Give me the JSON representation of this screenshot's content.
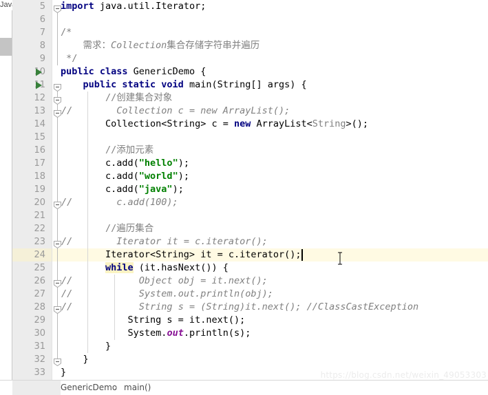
{
  "window": {
    "tab_stub_label": "Java",
    "breadcrumb": {
      "class_label": "GenericDemo",
      "separator": "›",
      "method_label": "main()"
    },
    "watermark": "https://blog.csdn.net/weixin_49053303"
  },
  "colors": {
    "keyword": "#000080",
    "string": "#008000",
    "comment": "#808080",
    "static_field": "#871094",
    "caret_line": "#fffae3",
    "identifier_highlight": "#fbf3c3",
    "gutter_bg": "#ececec",
    "editor_bg": "#ffffff",
    "line_number": "#999999",
    "run_marker": "#37803a"
  },
  "editor": {
    "caret_line_number": 24,
    "first_visible_line": 5,
    "last_visible_line": 33,
    "lines": [
      {
        "n": 5,
        "indent": 0,
        "run": false,
        "fold": "minus",
        "text_html": "<span class=\"kw\">import</span> java.util.Iterator;"
      },
      {
        "n": 6,
        "indent": 0,
        "run": false,
        "fold": "none",
        "text_html": ""
      },
      {
        "n": 7,
        "indent": 1,
        "run": false,
        "fold": "none",
        "text_html": "<span class=\"cmt\">/*</span>"
      },
      {
        "n": 8,
        "indent": 1,
        "run": false,
        "fold": "none",
        "text_html": "<span class=\"cmt\">    需求：</span><span class=\"cmtit\">Collection</span><span class=\"cmt\">集合存储字符串并遍历</span>"
      },
      {
        "n": 9,
        "indent": 1,
        "run": false,
        "fold": "none",
        "text_html": "<span class=\"cmt\"> */</span>"
      },
      {
        "n": 10,
        "indent": 0,
        "run": true,
        "fold": "none",
        "text_html": "<span class=\"kw\">public class</span> GenericDemo {"
      },
      {
        "n": 11,
        "indent": 0,
        "run": true,
        "fold": "minus",
        "text_html": "    <span class=\"kw\">public static void</span> main(String[] args) {"
      },
      {
        "n": 12,
        "indent": 0,
        "run": false,
        "fold": "minus",
        "text_html": "        <span class=\"cmt\">//创建集合对象</span>"
      },
      {
        "n": 13,
        "indent": 0,
        "run": false,
        "fold": "minus",
        "comment_prefix": true,
        "text_html": "          <span class=\"cmtit\">Collection c = new ArrayList();</span>"
      },
      {
        "n": 14,
        "indent": 0,
        "run": false,
        "fold": "none",
        "text_html": "        Collection&lt;String&gt; c = <span class=\"kw\">new</span> ArrayList&lt;<span class=\"cmt\">String</span>&gt;();"
      },
      {
        "n": 15,
        "indent": 0,
        "run": false,
        "fold": "none",
        "text_html": ""
      },
      {
        "n": 16,
        "indent": 0,
        "run": false,
        "fold": "none",
        "text_html": "        <span class=\"cmt\">//添加元素</span>"
      },
      {
        "n": 17,
        "indent": 0,
        "run": false,
        "fold": "none",
        "text_html": "        c.add(<span class=\"str\">\"hello\"</span>);"
      },
      {
        "n": 18,
        "indent": 0,
        "run": false,
        "fold": "none",
        "text_html": "        c.add(<span class=\"str\">\"world\"</span>);"
      },
      {
        "n": 19,
        "indent": 0,
        "run": false,
        "fold": "none",
        "text_html": "        c.add(<span class=\"str\">\"java\"</span>);"
      },
      {
        "n": 20,
        "indent": 0,
        "run": false,
        "fold": "minus",
        "comment_prefix": true,
        "text_html": "          <span class=\"cmtit\">c.add(100);</span>"
      },
      {
        "n": 21,
        "indent": 0,
        "run": false,
        "fold": "none",
        "text_html": ""
      },
      {
        "n": 22,
        "indent": 0,
        "run": false,
        "fold": "none",
        "text_html": "        <span class=\"cmt\">//遍历集合</span>"
      },
      {
        "n": 23,
        "indent": 0,
        "run": false,
        "fold": "minus",
        "comment_prefix": true,
        "text_html": "          <span class=\"cmtit\">Iterator it = c.iterator();</span>"
      },
      {
        "n": 24,
        "indent": 0,
        "run": false,
        "fold": "none",
        "text_html": "        Iterator&lt;String&gt; it = c.iterator();"
      },
      {
        "n": 25,
        "indent": 0,
        "run": false,
        "fold": "none",
        "text_html": "        <span class=\"kw hl\">while</span> (it.hasNext()) {"
      },
      {
        "n": 26,
        "indent": 0,
        "run": false,
        "fold": "minus",
        "comment_prefix": true,
        "text_html": "              <span class=\"cmtit\">Object obj = it.next();</span>"
      },
      {
        "n": 27,
        "indent": 0,
        "run": false,
        "fold": "none",
        "comment_prefix": true,
        "text_html": "              <span class=\"cmtit\">System.out.println(obj);</span>"
      },
      {
        "n": 28,
        "indent": 0,
        "run": false,
        "fold": "minus",
        "comment_prefix": true,
        "text_html": "              <span class=\"cmtit\">String s = (String)it.next(); //ClassCastException</span>"
      },
      {
        "n": 29,
        "indent": 0,
        "run": false,
        "fold": "none",
        "text_html": "            String s = it.next();"
      },
      {
        "n": 30,
        "indent": 0,
        "run": false,
        "fold": "none",
        "text_html": "            System.<span class=\"stat\">out</span>.println(s);"
      },
      {
        "n": 31,
        "indent": 0,
        "run": false,
        "fold": "none",
        "text_html": "        }"
      },
      {
        "n": 32,
        "indent": 0,
        "run": false,
        "fold": "minus",
        "text_html": "    }"
      },
      {
        "n": 33,
        "indent": 0,
        "run": false,
        "fold": "none",
        "text_html": "}"
      }
    ]
  }
}
